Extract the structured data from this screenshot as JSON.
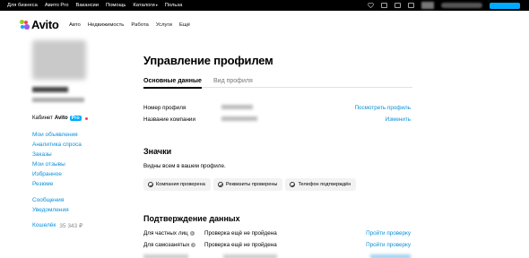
{
  "topbar": {
    "links": [
      "Для бизнеса",
      "Авито Pro",
      "Вакансии",
      "Помощь",
      "Каталоги",
      "Польза"
    ]
  },
  "header": {
    "logo_text": "Avito",
    "nav": [
      "Авто",
      "Недвижимость",
      "Работа",
      "Услуги",
      "Ещё"
    ]
  },
  "sidebar": {
    "cabinet_label": "Кабинет",
    "cabinet_brand": "Avito",
    "cabinet_badge": "Pro",
    "menu": [
      "Мои объявления",
      "Аналитика спроса",
      "Заказы",
      "Мои отзывы",
      "Избранное",
      "Резюме"
    ],
    "menu2": [
      "Сообщения",
      "Уведомления"
    ],
    "wallet_label": "Кошелёк",
    "wallet_amount": "35 343 ₽"
  },
  "main": {
    "title": "Управление профилем",
    "tabs": [
      "Основные данные",
      "Вид профиля"
    ],
    "profile_number_label": "Номер профиля",
    "profile_number_action": "Посмотреть профиль",
    "company_name_label": "Название компании",
    "company_name_action": "Изменить",
    "badges_title": "Значки",
    "badges_subtitle": "Видны всем в вашем профиле.",
    "badges": [
      "Компания проверена",
      "Реквизиты проверены",
      "Телефон подтверждён"
    ],
    "verification_title": "Подтверждение данных",
    "verification_rows": [
      {
        "label": "Для частных лиц",
        "status": "Проверка ещё не пройдена",
        "action": "Пройти проверку"
      },
      {
        "label": "Для самозанятых",
        "status": "Проверка ещё не пройдена",
        "action": "Пройти проверку"
      }
    ]
  },
  "colors": {
    "accent_blue": "#00aaff",
    "link_blue": "#0a8fd8",
    "logo_green": "#97cf26",
    "logo_blue": "#00aaff",
    "logo_red": "#ff4053",
    "logo_purple": "#965eeb",
    "notification_red": "#f73c57"
  }
}
